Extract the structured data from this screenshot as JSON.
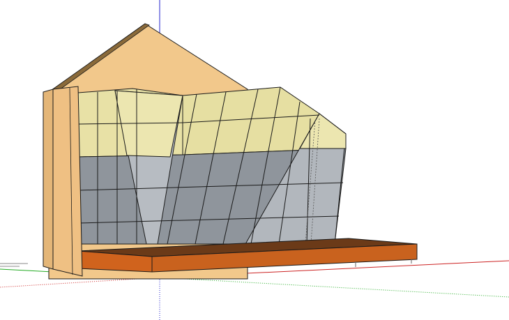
{
  "app": {
    "view": "3d-model-viewport"
  },
  "colors": {
    "background": "#ffffff",
    "axis_blue": "#2222cc",
    "axis_red": "#cc2222",
    "axis_green": "#22aa22",
    "roof_gable": "#f2c88b",
    "side_panel": "#efc083",
    "wood_panel_top": "#e9e3a8",
    "grey_panel": "#8f959c",
    "light_grey_panel": "#b7bcc2",
    "platform_top": "#6b3a18",
    "platform_front": "#c9621e",
    "edge": "#1a1a1a"
  },
  "scene": {
    "objects": [
      "gable-wall",
      "climbing-wall",
      "side-panel",
      "platform"
    ]
  }
}
